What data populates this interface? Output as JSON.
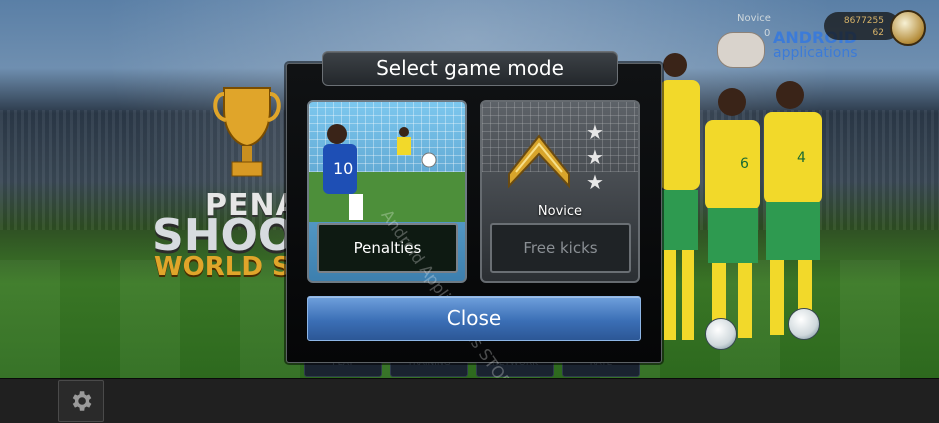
{
  "dialog": {
    "title": "Select game mode",
    "modes": [
      {
        "label": "Penalties",
        "locked": false
      },
      {
        "label": "Free kicks",
        "locked": true,
        "rank": "Novice",
        "stars": 3
      }
    ],
    "close_label": "Close"
  },
  "hud": {
    "level_label": "Novice",
    "level_value": "0",
    "coins_top": "8677255",
    "coins_bottom": "62"
  },
  "logo": {
    "line1": "PENALT",
    "line2": "SHOOTO",
    "line3": "WORLD SO"
  },
  "watermark": {
    "brand": "ANDROID",
    "sub": "applications",
    "diagonal": "Android Applications STORE"
  },
  "behind_buttons": [
    "PLAY",
    "TRAINING",
    "NETWORK",
    "RATE"
  ],
  "colors": {
    "close_button": "#3b6fb6",
    "selected_card_border": "#6e7a84",
    "brand_blue": "#3c7bd8",
    "logo_gold": "#e0a52a"
  },
  "icons": {
    "settings": "gear-icon",
    "coin": "coin-icon",
    "rank": "chevron-rank-icon"
  }
}
